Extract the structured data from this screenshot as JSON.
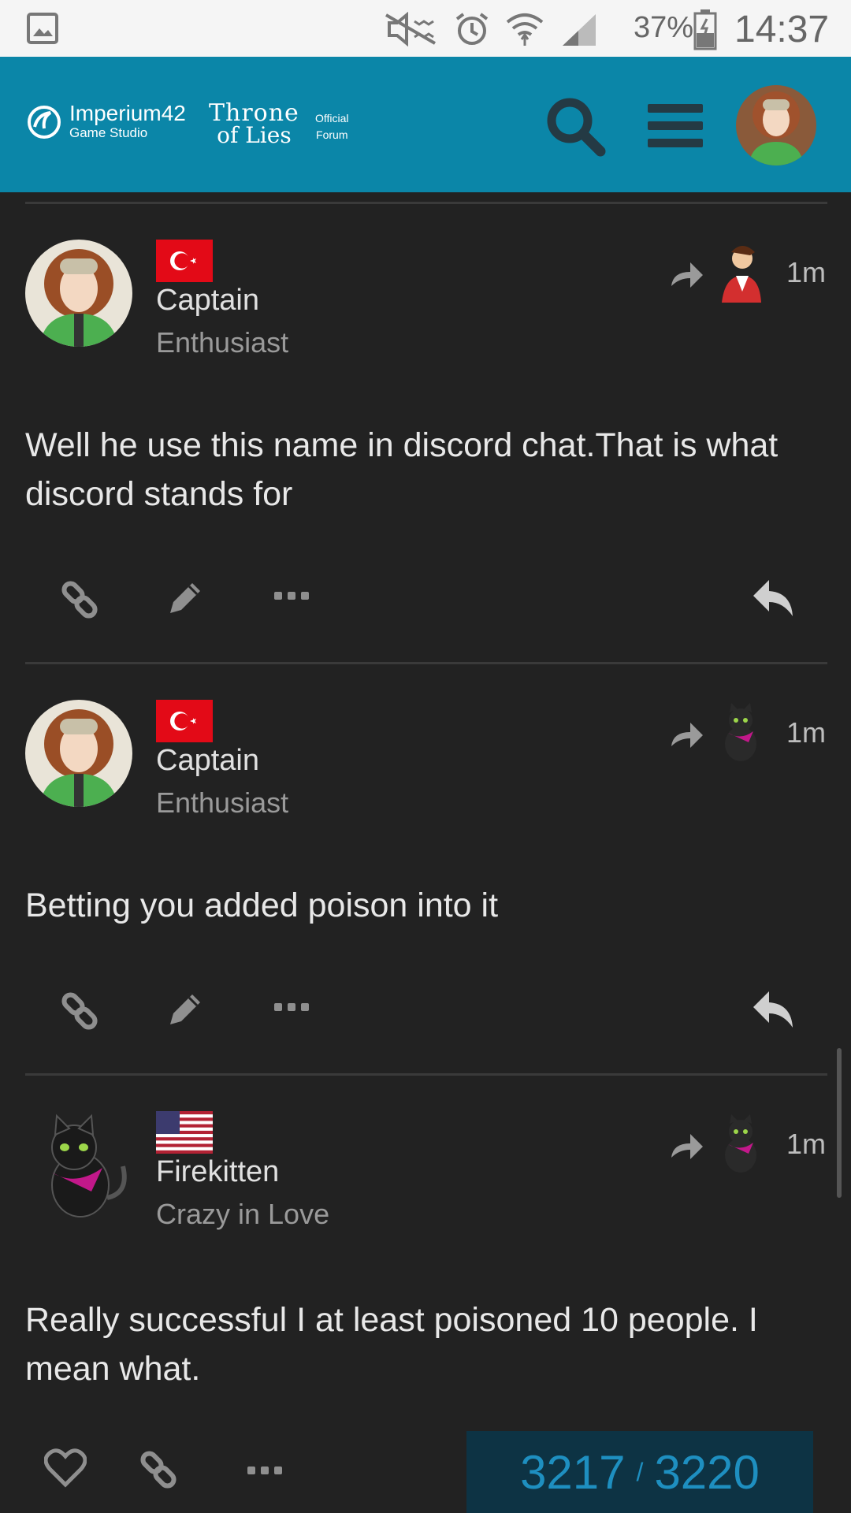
{
  "statusbar": {
    "battery": "37%",
    "time": "14:37",
    "icons": [
      "gallery-icon",
      "mute-icon",
      "alarm-icon",
      "wifi-icon",
      "signal-icon",
      "battery-icon"
    ]
  },
  "header": {
    "brand_name": "Imperium42",
    "brand_sub": "Game Studio",
    "tol_line1": "Throne",
    "tol_line2": "of Lies",
    "official_line1": "Official",
    "official_line2": "Forum",
    "bg_color": "#0b86a8"
  },
  "posts": [
    {
      "username": "Captain",
      "title": "Enthusiast",
      "flag": "turkey",
      "time": "1m",
      "body": "Well he use this name in discord chat.That is what discord stands for"
    },
    {
      "username": "Captain",
      "title": "Enthusiast",
      "flag": "turkey",
      "time": "1m",
      "body": "Betting you added poison into it"
    },
    {
      "username": "Firekitten",
      "title": "Crazy in Love",
      "flag": "usa",
      "time": "1m",
      "body": "Really successful I at least poisoned 10 people. I mean what."
    }
  ],
  "progress": {
    "current": "3217",
    "separator": "/",
    "total": "3220"
  }
}
